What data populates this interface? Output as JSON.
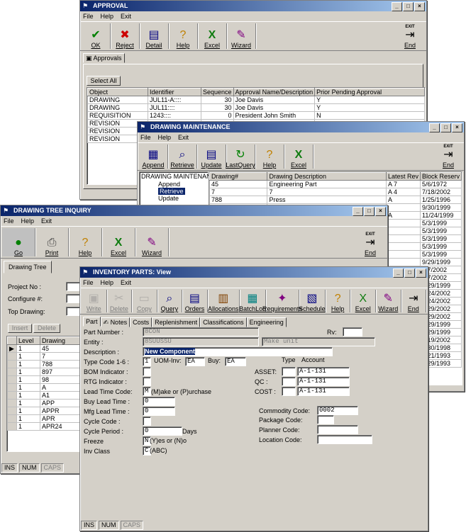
{
  "approval": {
    "title": "APPROVAL",
    "menu": [
      "File",
      "Help",
      "Exit"
    ],
    "toolbar": [
      {
        "label": "OK",
        "icon": "✔",
        "color": "#008000"
      },
      {
        "label": "Reject",
        "icon": "✖",
        "color": "#cc0000"
      },
      {
        "label": "Detail",
        "icon": "▤",
        "color": "#000080"
      },
      {
        "label": "Help",
        "icon": "?",
        "color": "#c08000"
      },
      {
        "label": "Excel",
        "icon": "X",
        "color": "#107c10"
      },
      {
        "label": "Wizard",
        "icon": "✎",
        "color": "#800080"
      }
    ],
    "end_label": "End",
    "exit_label": "EXIT",
    "tab_label": "Approvals",
    "select_all": "Select All",
    "columns": [
      "Object",
      "Identifier",
      "Sequence",
      "Approval Name/Description",
      "Prior Pending Approval"
    ],
    "rows": [
      [
        "DRAWING",
        "JUL11-A::::",
        "30",
        "Joe Davis",
        "Y"
      ],
      [
        "DRAWING",
        "JUL11::::",
        "30",
        "Joe Davis",
        "Y"
      ],
      [
        "REQUISITION",
        "1243::::",
        "0",
        "President John Smith",
        "N"
      ],
      [
        "REVISION",
        "",
        "",
        "",
        ""
      ],
      [
        "REVISION",
        "",
        "",
        "",
        ""
      ],
      [
        "REVISION",
        "",
        "",
        "",
        ""
      ]
    ]
  },
  "drawing_maint": {
    "title": "DRAWING MAINTENANCE",
    "menu": [
      "File",
      "Help",
      "Exit"
    ],
    "toolbar": [
      {
        "label": "Append",
        "icon": "▦",
        "color": "#000080"
      },
      {
        "label": "Retrieve",
        "icon": "⌕",
        "color": "#000080"
      },
      {
        "label": "Update",
        "icon": "▤",
        "color": "#000080"
      },
      {
        "label": "LastQuery",
        "icon": "↻",
        "color": "#008000"
      },
      {
        "label": "Help",
        "icon": "?",
        "color": "#c08000"
      },
      {
        "label": "Excel",
        "icon": "X",
        "color": "#107c10"
      }
    ],
    "end_label": "End",
    "exit_label": "EXIT",
    "tree": [
      "DRAWING MAINTENANCE",
      "Append",
      "Retrieve",
      "Update"
    ],
    "columns": [
      "Drawing#",
      "Drawing Description",
      "Latest Rev",
      "Block Reserv"
    ],
    "rows": [
      [
        "45",
        "Engineering Part",
        "A 7",
        "5/6/1972"
      ],
      [
        "7",
        "7",
        "A 4",
        "7/18/2002"
      ],
      [
        "788",
        "Press",
        "A",
        "1/25/1996"
      ],
      [
        "",
        "",
        "",
        "9/30/1999"
      ],
      [
        "",
        "",
        "A",
        "11/24/1999"
      ],
      [
        "",
        "",
        "",
        "5/3/1999"
      ],
      [
        "",
        "",
        "",
        "5/3/1999"
      ],
      [
        "",
        "",
        "",
        "5/3/1999"
      ],
      [
        "",
        "",
        "",
        "5/3/1999"
      ],
      [
        "",
        "",
        "",
        "5/3/1999"
      ],
      [
        "",
        "",
        "",
        "9/29/1999"
      ],
      [
        "",
        "",
        "",
        "7/7/2002"
      ],
      [
        "",
        "",
        "",
        "7/7/2002"
      ],
      [
        "",
        "",
        "",
        "8/29/1999"
      ],
      [
        "",
        "",
        "",
        "9/24/2002"
      ],
      [
        "",
        "",
        "",
        "8/24/2002"
      ],
      [
        "",
        "",
        "",
        "3/29/2002"
      ],
      [
        "",
        "",
        "",
        "3/29/2002"
      ],
      [
        "",
        "",
        "",
        "9/29/1999"
      ],
      [
        "",
        "",
        "",
        "9/29/1999"
      ],
      [
        "",
        "",
        "",
        "5/19/2002"
      ],
      [
        "",
        "",
        "",
        "2/30/1998"
      ],
      [
        "",
        "",
        "",
        "2/21/1993"
      ],
      [
        "",
        "",
        "",
        "8/29/1993"
      ]
    ]
  },
  "tree_inquiry": {
    "title": "DRAWING TREE INQUIRY",
    "menu": [
      "File",
      "Help",
      "Exit"
    ],
    "toolbar": [
      {
        "label": "Go",
        "icon": "●",
        "color": "#008000"
      },
      {
        "label": "Print",
        "icon": "⎙",
        "color": "#404040"
      },
      {
        "label": "Help",
        "icon": "?",
        "color": "#c08000"
      },
      {
        "label": "Excel",
        "icon": "X",
        "color": "#107c10"
      },
      {
        "label": "Wizard",
        "icon": "✎",
        "color": "#800080"
      }
    ],
    "end_label": "End",
    "exit_label": "EXIT",
    "tab_label": "Drawing Tree",
    "project_label": "Project No :",
    "configure_label": "Configure #:",
    "top_label": "Top Drawing:",
    "insert_label": "Insert",
    "delete_label": "Delete",
    "columns": [
      "Level",
      "Drawing"
    ],
    "rows": [
      [
        "1",
        "45"
      ],
      [
        "1",
        "7"
      ],
      [
        "1",
        "788"
      ],
      [
        "1",
        "897"
      ],
      [
        "1",
        "98"
      ],
      [
        "1",
        "A"
      ],
      [
        "1",
        "A1"
      ],
      [
        "1",
        "APP"
      ],
      [
        "1",
        "APPR"
      ],
      [
        "1",
        "APR"
      ],
      [
        "1",
        "APR24"
      ]
    ],
    "status": [
      "INS",
      "NUM",
      "CAPS"
    ]
  },
  "inventory": {
    "title": "INVENTORY PARTS: View",
    "menu": [
      "File",
      "Help",
      "Exit"
    ],
    "toolbar": [
      {
        "label": "Write",
        "icon": "▣",
        "color": "#808080",
        "disabled": true
      },
      {
        "label": "Delete",
        "icon": "✂",
        "color": "#808080",
        "disabled": true
      },
      {
        "label": "Copy",
        "icon": "▭",
        "color": "#808080",
        "disabled": true
      },
      {
        "label": "Query",
        "icon": "⌕",
        "color": "#000080"
      },
      {
        "label": "Orders",
        "icon": "▤",
        "color": "#000080"
      },
      {
        "label": "Allocations",
        "icon": "▥",
        "color": "#804000"
      },
      {
        "label": "BatchLoc",
        "icon": "▦",
        "color": "#008080"
      },
      {
        "label": "Requirements",
        "icon": "✦",
        "color": "#800080"
      },
      {
        "label": "Schedule",
        "icon": "▧",
        "color": "#000080"
      },
      {
        "label": "Help",
        "icon": "?",
        "color": "#c08000"
      },
      {
        "label": "Excel",
        "icon": "X",
        "color": "#107c10"
      },
      {
        "label": "Wizard",
        "icon": "✎",
        "color": "#800080"
      },
      {
        "label": "End",
        "icon": "⇥",
        "color": "#000000"
      }
    ],
    "tabs": [
      "Part",
      "Notes",
      "Costs",
      "Replenishment",
      "Classifications",
      "Engineering"
    ],
    "fields": {
      "part_number_label": "Part Number :",
      "part_number": "8CON",
      "rv_label": "Rv:",
      "entity_label": "Entity :",
      "entity": "8SUUSSU",
      "entity_desc": "Make unit",
      "description_label": "Description :",
      "description": "New Component",
      "type_code_label": "Type Code 1-6 :",
      "type_code": "1",
      "uom_inv_label": "UOM-Inv:",
      "uom_inv": "EA",
      "buy_label": "Buy:",
      "buy": "EA",
      "type_label": "Type",
      "account_label": "Account",
      "bom_label": "BOM Indicator :",
      "rtg_label": "RTG Indicator :",
      "lead_code_label": "Lead Time Code:",
      "lead_code": "M",
      "lead_code_hint": "(M)ake or (P)urchase",
      "buy_lead_label": "Buy Lead Time :",
      "buy_lead": "0",
      "mfg_lead_label": "Mfg Lead Time :",
      "mfg_lead": "0",
      "cycle_code_label": "Cycle Code :",
      "cycle_period_label": "Cycle Period :",
      "cycle_period": "0",
      "days_label": "Days",
      "freeze_label": "Freeze",
      "freeze": "N",
      "freeze_hint": "(Y)es or (N)o",
      "inv_class_label": "Inv Class",
      "inv_class": "C",
      "inv_class_hint": "(ABC)",
      "asset_label": "ASSET:",
      "asset": "A-1-131",
      "qc_label": "QC :",
      "qc": "A-1-131",
      "cost_label": "COST :",
      "cost": "A-1-131",
      "commodity_label": "Commodity Code:",
      "commodity": "0002",
      "package_label": "Package Code:",
      "planner_label": "Planner Code:",
      "location_label": "Location Code:"
    },
    "status": [
      "INS",
      "NUM",
      "CAPS"
    ]
  }
}
